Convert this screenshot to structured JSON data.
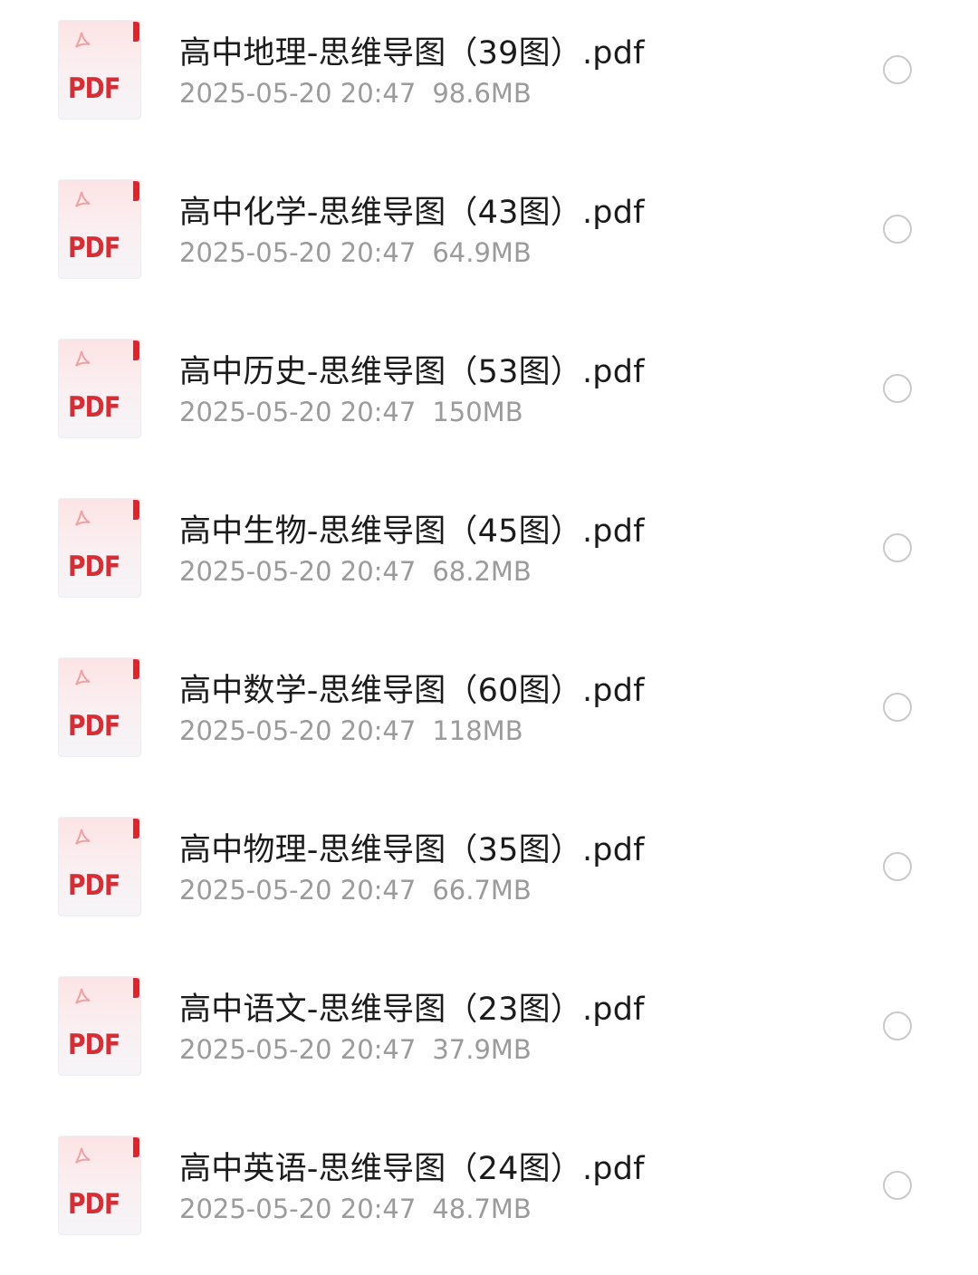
{
  "files": [
    {
      "icon_label": "PDF",
      "name": "高中地理-思维导图（39图）.pdf",
      "date": "2025-05-20 20:47",
      "size": "98.6MB"
    },
    {
      "icon_label": "PDF",
      "name": "高中化学-思维导图（43图）.pdf",
      "date": "2025-05-20 20:47",
      "size": "64.9MB"
    },
    {
      "icon_label": "PDF",
      "name": "高中历史-思维导图（53图）.pdf",
      "date": "2025-05-20 20:47",
      "size": "150MB"
    },
    {
      "icon_label": "PDF",
      "name": "高中生物-思维导图（45图）.pdf",
      "date": "2025-05-20 20:47",
      "size": "68.2MB"
    },
    {
      "icon_label": "PDF",
      "name": "高中数学-思维导图（60图）.pdf",
      "date": "2025-05-20 20:47",
      "size": "118MB"
    },
    {
      "icon_label": "PDF",
      "name": "高中物理-思维导图（35图）.pdf",
      "date": "2025-05-20 20:47",
      "size": "66.7MB"
    },
    {
      "icon_label": "PDF",
      "name": "高中语文-思维导图（23图）.pdf",
      "date": "2025-05-20 20:47",
      "size": "37.9MB"
    },
    {
      "icon_label": "PDF",
      "name": "高中英语-思维导图（24图）.pdf",
      "date": "2025-05-20 20:47",
      "size": "48.7MB"
    }
  ],
  "icons": {
    "file_type": "pdf-file-icon",
    "select": "radio-unchecked-icon"
  },
  "colors": {
    "pdf_red": "#d32f36",
    "name_text": "#1b1b1b",
    "meta_text": "#9b9b9b",
    "radio_border": "#c9c9c9"
  }
}
